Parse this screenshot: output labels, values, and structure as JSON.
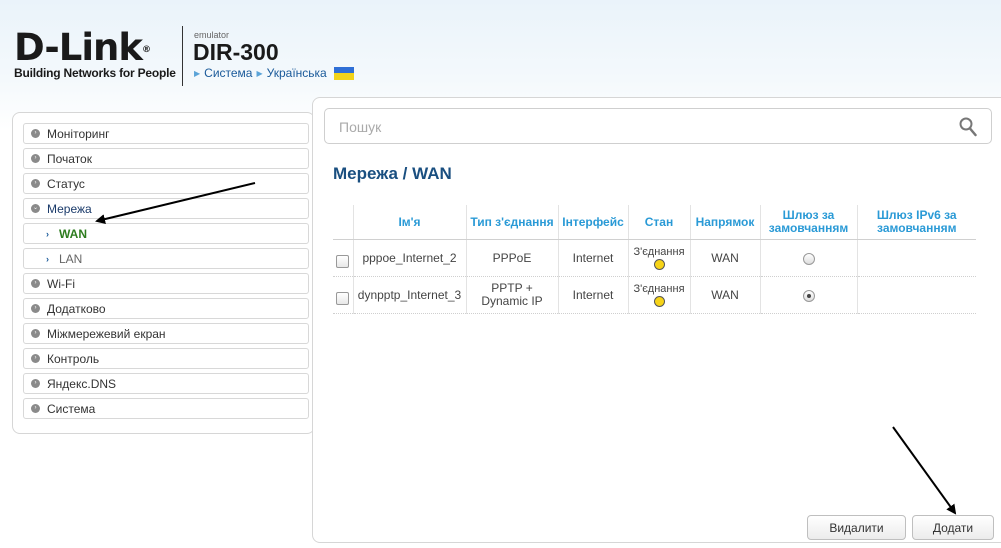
{
  "header": {
    "logo_text": "D-Link",
    "logo_reg": "®",
    "tagline": "Building Networks for People",
    "emulator": "emulator",
    "model": "DIR-300",
    "crumbs": [
      "Система",
      "Українська"
    ]
  },
  "sidebar": {
    "items": [
      {
        "label": "Моніторинг"
      },
      {
        "label": "Початок"
      },
      {
        "label": "Статус"
      },
      {
        "label": "Мережа"
      },
      {
        "label": "WAN"
      },
      {
        "label": "LAN"
      },
      {
        "label": "Wi-Fi"
      },
      {
        "label": "Додатково"
      },
      {
        "label": "Міжмережевий екран"
      },
      {
        "label": "Контроль"
      },
      {
        "label": "Яндекс.DNS"
      },
      {
        "label": "Система"
      }
    ]
  },
  "search": {
    "placeholder": "Пошук"
  },
  "page": {
    "title": "Мережа /  WAN"
  },
  "table": {
    "headers": [
      "Ім'я",
      "Тип з'єднання",
      "Інтерфейс",
      "Стан",
      "Напрямок",
      "Шлюз за замовчанням",
      "Шлюз IPv6 за замовчанням"
    ],
    "rows": [
      {
        "name": "pppoe_Internet_2",
        "type": "PPPoE",
        "iface": "Internet",
        "state": "З'єднання",
        "dir": "WAN",
        "gw_default": false
      },
      {
        "name": "dynpptp_Internet_3",
        "type": "PPTP + Dynamic IP",
        "iface": "Internet",
        "state": "З'єднання",
        "dir": "WAN",
        "gw_default": true
      }
    ]
  },
  "buttons": {
    "delete": "Видалити",
    "add": "Додати"
  },
  "colors": {
    "status_dot": "#f6d317",
    "title": "#1a4f80",
    "table_header": "#2a9ad6"
  }
}
